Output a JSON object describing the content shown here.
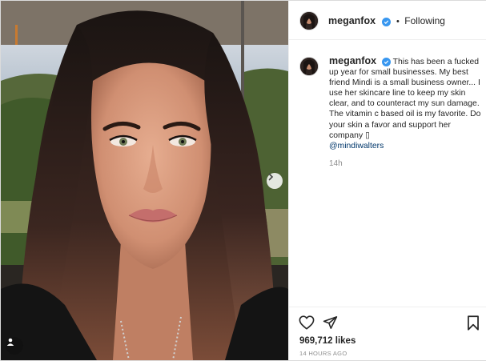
{
  "post": {
    "username": "meganfox",
    "follow_status": "Following",
    "dot": "•",
    "caption": "This has been a fucked up year for small businesses. My best friend Mindi is a small business owner... I use her skincare line to keep my skin clear, and to counteract my sun damage. The vitamin c based oil is my favorite. Do your skin a favor and support her company ",
    "caption_emoji": "▯",
    "mention": "@mindiwalters",
    "time_ago": "14h",
    "likes": "969,712 likes",
    "date": "14 HOURS AGO"
  },
  "icons": {
    "verified": "verified-badge-icon",
    "next": "chevron-right-icon",
    "tag": "user-tag-icon",
    "like": "heart-icon",
    "share": "paper-plane-icon",
    "save": "bookmark-icon"
  },
  "colors": {
    "verified": "#3897f0",
    "mention": "#00376b",
    "muted": "#8e8e8e"
  }
}
